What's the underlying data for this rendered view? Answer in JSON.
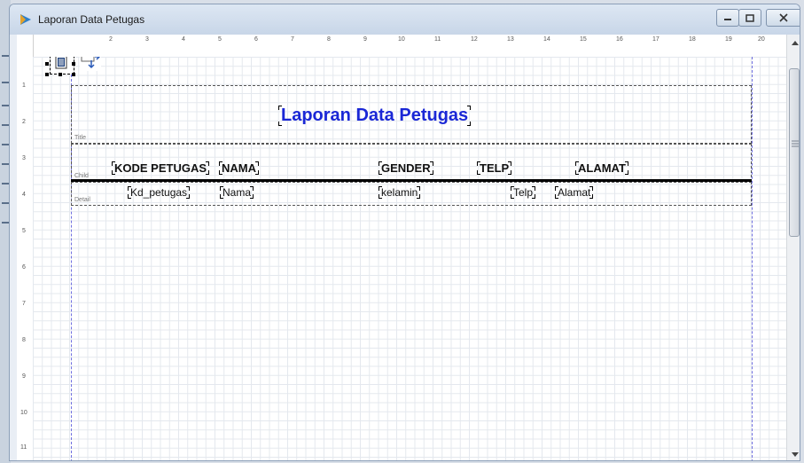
{
  "window": {
    "title": "Laporan Data Petugas"
  },
  "ruler": {
    "top": [
      "2",
      "3",
      "4",
      "5",
      "6",
      "7",
      "8",
      "9",
      "10",
      "11",
      "12",
      "13",
      "14",
      "15",
      "16",
      "17",
      "18",
      "19",
      "20"
    ],
    "left": [
      "1",
      "2",
      "3",
      "4",
      "5",
      "6",
      "7",
      "8",
      "9",
      "10",
      "11"
    ]
  },
  "bands": {
    "title": "Title",
    "child": "Child",
    "detail": "Detail"
  },
  "report": {
    "title": "Laporan Data Petugas",
    "headers": [
      "KODE PETUGAS",
      "NAMA",
      "GENDER",
      "TELP",
      "ALAMAT"
    ],
    "detail_fields": [
      "Kd_petugas",
      "Nama",
      "kelamin",
      "Telp",
      "Alamat"
    ]
  },
  "colors": {
    "title": "#1a27d6",
    "grid": "#e4e8ee",
    "margin": "#7070e0"
  }
}
